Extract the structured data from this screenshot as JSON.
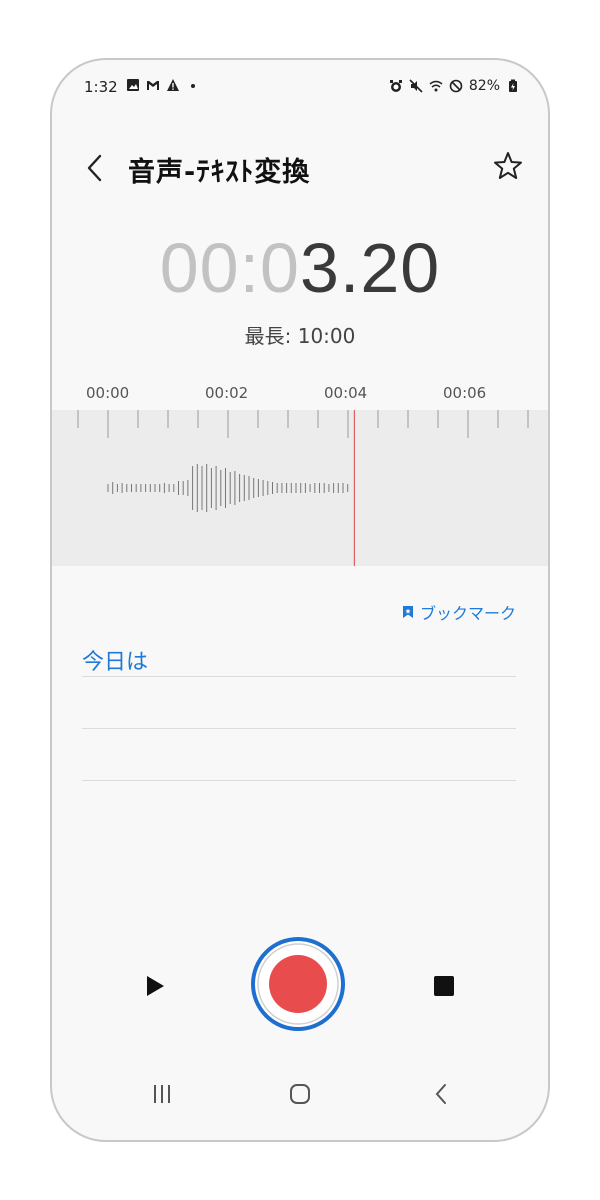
{
  "status_bar": {
    "time": "1:32",
    "battery": "82%",
    "left_icons": [
      "image-icon",
      "gmail-icon",
      "warning-icon",
      "dot-icon"
    ],
    "right_icons": [
      "alarm-icon",
      "mute-icon",
      "wifi-icon",
      "do-not-disturb-icon",
      "battery-icon"
    ]
  },
  "header": {
    "title": "音声-ﾃｷｽﾄ変換"
  },
  "timer": {
    "dim_part": "00:0",
    "main_part": "3.20"
  },
  "max_length": "最長: 10:00",
  "timeline": {
    "ticks": [
      "00:00",
      "00:02",
      "00:04",
      "00:06"
    ]
  },
  "bookmark_label": "ブックマーク",
  "transcript_text": "今日は",
  "colors": {
    "accent": "#1e7ad6",
    "record": "#e84c4c",
    "playhead": "#e06060"
  }
}
